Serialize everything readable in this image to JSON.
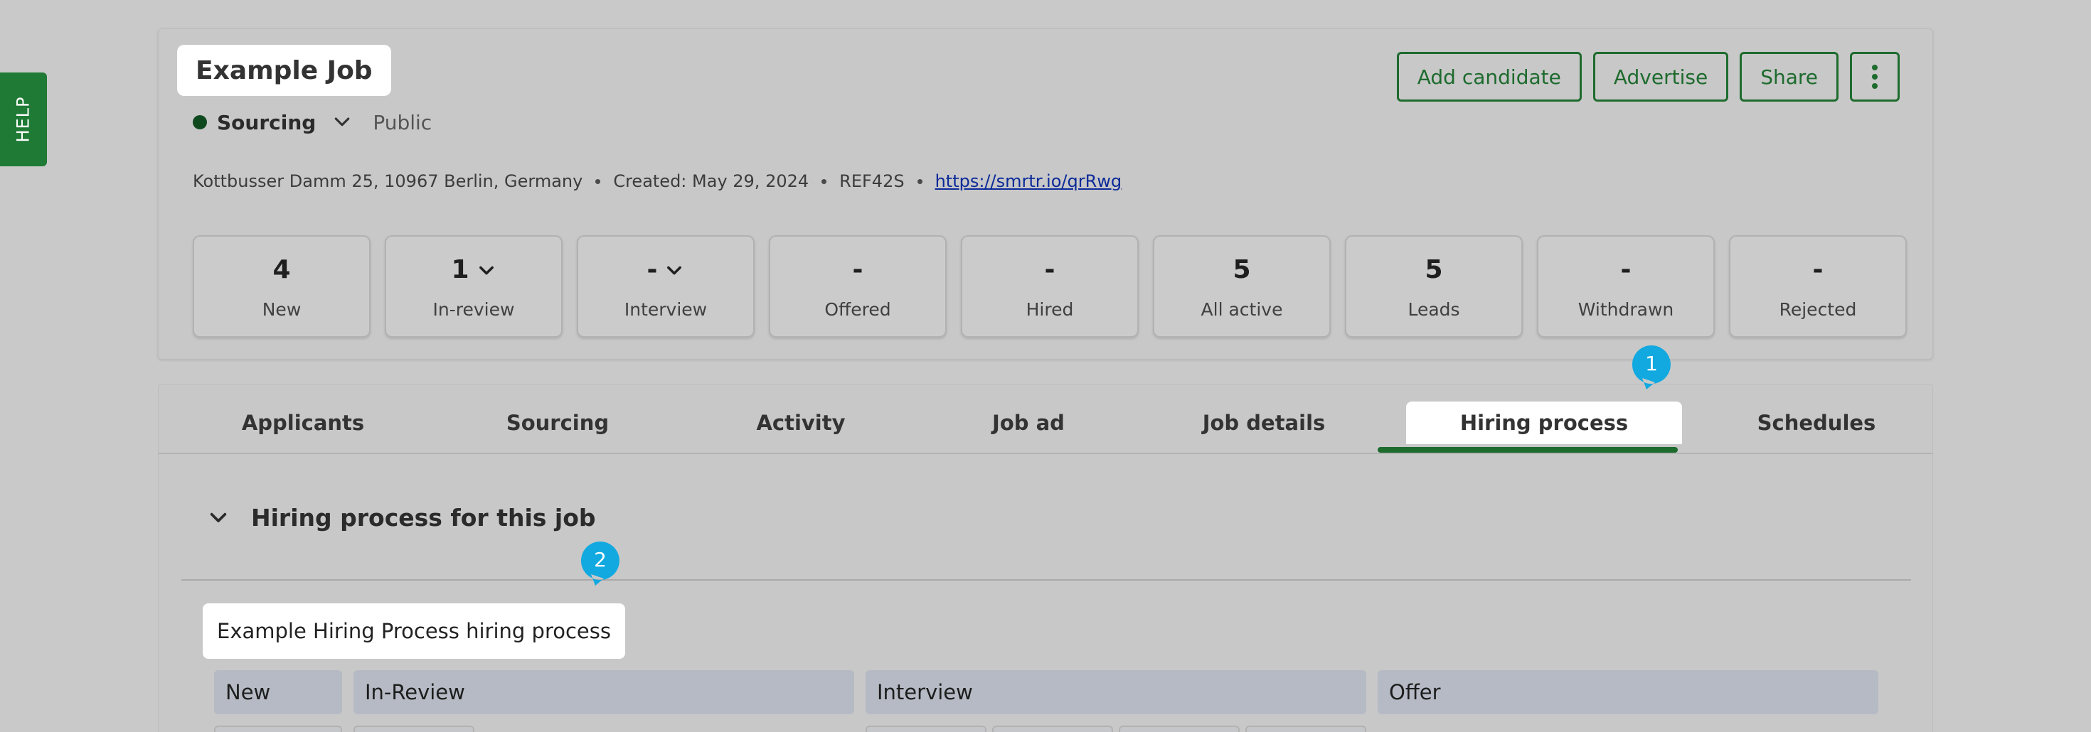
{
  "help_tab": {
    "label": "HELP"
  },
  "job": {
    "title": "Example Job",
    "status": "Sourcing",
    "visibility": "Public",
    "status_color": "#0f4a1f"
  },
  "actions": {
    "add_candidate": "Add candidate",
    "advertise": "Advertise",
    "share": "Share",
    "more_icon": "vertical-ellipsis-icon"
  },
  "meta": {
    "location": "Kottbusser Damm 25, 10967 Berlin, Germany",
    "created": "Created: May 29, 2024",
    "reference": "REF42S",
    "link": "https://smrtr.io/qrRwg"
  },
  "stats": [
    {
      "value": "4",
      "label": "New",
      "dropdown": false
    },
    {
      "value": "1",
      "label": "In-review",
      "dropdown": true
    },
    {
      "value": "-",
      "label": "Interview",
      "dropdown": true
    },
    {
      "value": "-",
      "label": "Offered",
      "dropdown": false
    },
    {
      "value": "-",
      "label": "Hired",
      "dropdown": false
    },
    {
      "value": "5",
      "label": "All active",
      "dropdown": false
    },
    {
      "value": "5",
      "label": "Leads",
      "dropdown": false
    },
    {
      "value": "-",
      "label": "Withdrawn",
      "dropdown": false
    },
    {
      "value": "-",
      "label": "Rejected",
      "dropdown": false
    }
  ],
  "tabs": [
    {
      "label": "Applicants"
    },
    {
      "label": "Sourcing"
    },
    {
      "label": "Activity"
    },
    {
      "label": "Job ad"
    },
    {
      "label": "Job details"
    },
    {
      "label": "Hiring process",
      "active": true
    },
    {
      "label": "Schedules"
    }
  ],
  "hiring_process": {
    "heading": "Hiring process for this job",
    "name": "Example Hiring Process hiring process",
    "stages": [
      "New",
      "In-Review",
      "Interview",
      "Offer"
    ]
  },
  "markers": [
    {
      "number": "1"
    },
    {
      "number": "2"
    }
  ],
  "colors": {
    "accent": "#1e6b2e",
    "marker": "#12a9e0",
    "link": "#0b2a99",
    "stage_bg": "#b5bac4"
  }
}
